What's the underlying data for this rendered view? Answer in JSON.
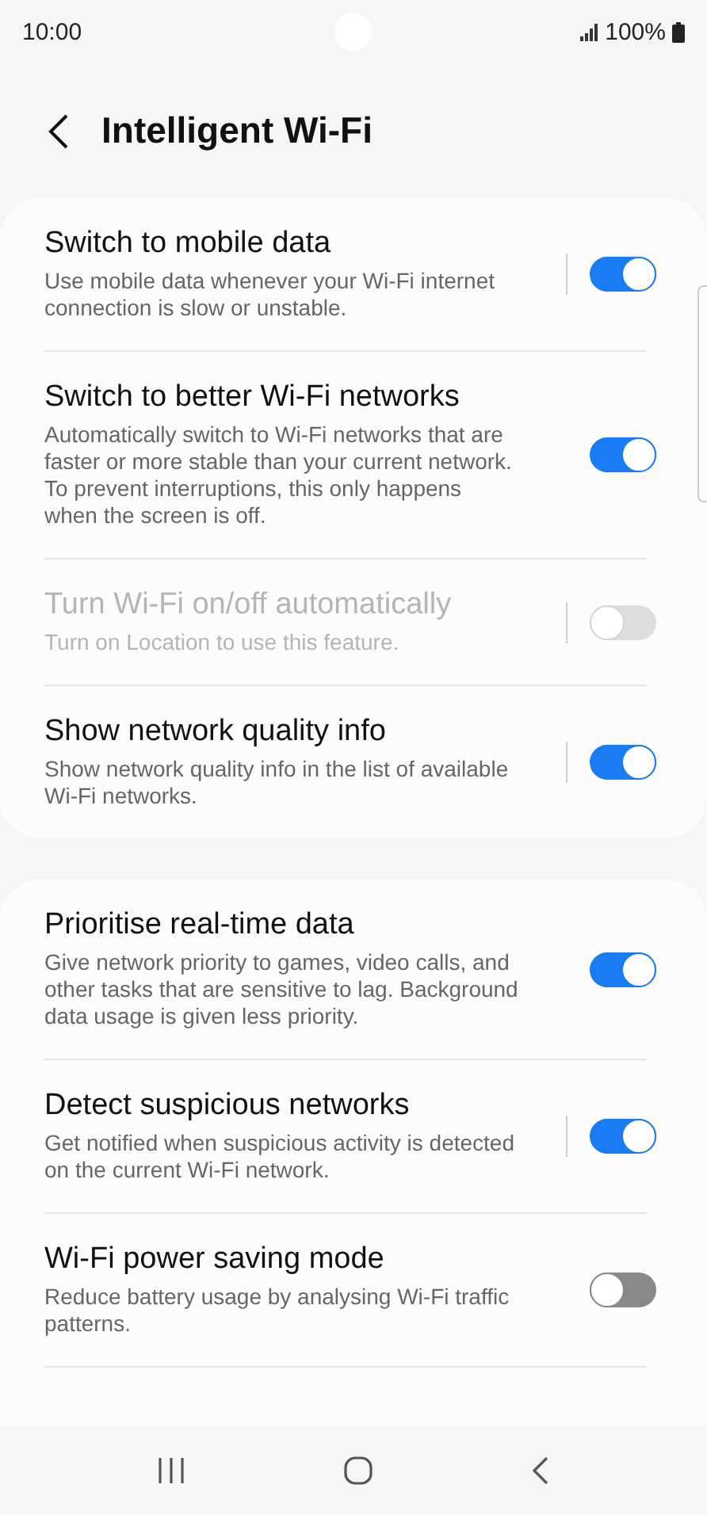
{
  "status_bar": {
    "time": "10:00",
    "battery": "100%"
  },
  "header": {
    "title": "Intelligent Wi-Fi"
  },
  "groups": [
    {
      "items": [
        {
          "title": "Switch to mobile data",
          "description": "Use mobile data whenever your Wi-Fi internet connection is slow or unstable.",
          "on": true,
          "disabled": false,
          "divider": true
        },
        {
          "title": "Switch to better Wi-Fi networks",
          "description": "Automatically switch to Wi-Fi networks that are faster or more stable than your current network. To prevent interruptions, this only happens when the screen is off.",
          "on": true,
          "disabled": false,
          "divider": false
        },
        {
          "title": "Turn Wi-Fi on/off automatically",
          "description": "Turn on Location to use this feature.",
          "on": false,
          "disabled": true,
          "divider": true
        },
        {
          "title": "Show network quality info",
          "description": "Show network quality info in the list of available Wi-Fi networks.",
          "on": true,
          "disabled": false,
          "divider": true
        }
      ]
    },
    {
      "items": [
        {
          "title": "Prioritise real-time data",
          "description": "Give network priority to games, video calls, and other tasks that are sensitive to lag. Background data usage is given less priority.",
          "on": true,
          "disabled": false,
          "divider": false
        },
        {
          "title": "Detect suspicious networks",
          "description": "Get notified when suspicious activity is detected on the current Wi-Fi network.",
          "on": true,
          "disabled": false,
          "divider": true
        },
        {
          "title": "Wi-Fi power saving mode",
          "description": "Reduce battery usage by analysing Wi-Fi traffic patterns.",
          "on": false,
          "disabled": false,
          "divider": false
        }
      ]
    }
  ]
}
